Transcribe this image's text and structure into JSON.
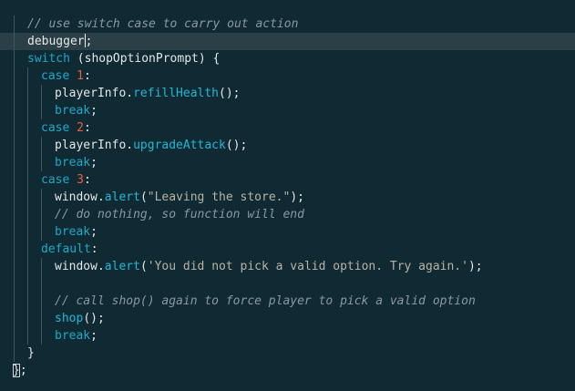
{
  "editor": {
    "lines": {
      "l1": {
        "comment": "// use switch case to carry out action"
      },
      "l2": {
        "code": "debugger",
        "after": ";"
      },
      "l3": {
        "kw": "switch",
        "rest": " (shopOptionPrompt) {"
      },
      "l4": {
        "kw": "case ",
        "num": "1",
        "rest": ":"
      },
      "l5": {
        "obj": "playerInfo.",
        "fn": "refillHealth",
        "rest": "();"
      },
      "l6": {
        "kw": "break",
        "rest": ";"
      },
      "l7": {
        "kw": "case ",
        "num": "2",
        "rest": ":"
      },
      "l8": {
        "obj": "playerInfo.",
        "fn": "upgradeAttack",
        "rest": "();"
      },
      "l9": {
        "kw": "break",
        "rest": ";"
      },
      "l10": {
        "kw": "case ",
        "num": "3",
        "rest": ":"
      },
      "l11": {
        "obj": "window.",
        "fn": "alert",
        "open": "(",
        "str": "\"Leaving the store.\"",
        "rest": ");"
      },
      "l12": {
        "comment": "// do nothing, so function will end"
      },
      "l13": {
        "kw": "break",
        "rest": ";"
      },
      "l14": {
        "kw": "default",
        "rest": ":"
      },
      "l15": {
        "obj": "window.",
        "fn": "alert",
        "open": "(",
        "str": "'You did not pick a valid option. Try again.'",
        "rest": ");"
      },
      "l16": {},
      "l17": {
        "comment": "// call shop() again to force player to pick a valid option"
      },
      "l18": {
        "fn": "shop",
        "rest": "();"
      },
      "l19": {
        "kw": "break",
        "rest": ";"
      },
      "l20": {
        "rest": "}"
      },
      "l21": {
        "brace": "}",
        "rest": ";"
      }
    }
  }
}
